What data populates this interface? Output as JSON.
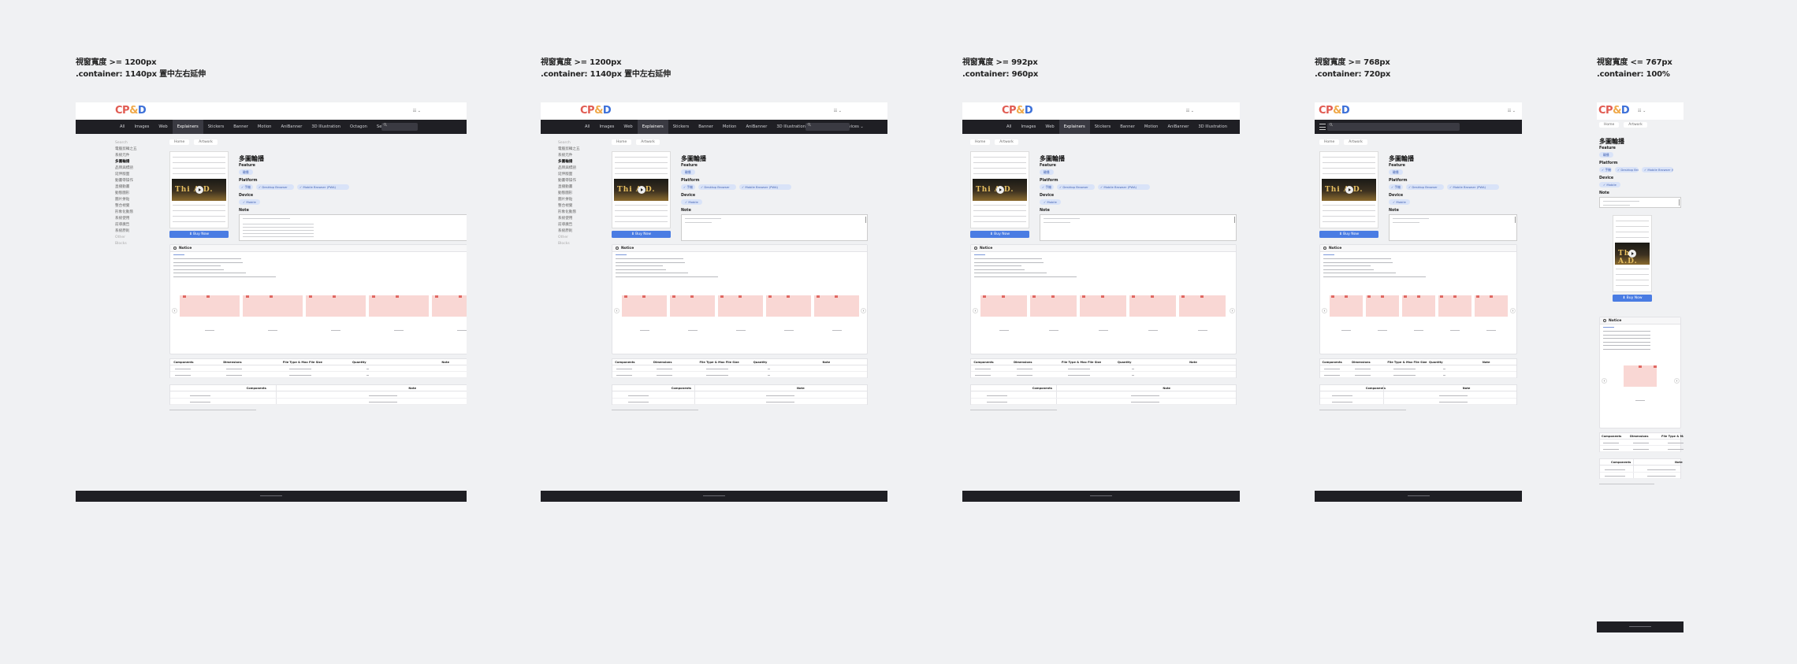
{
  "captions": [
    {
      "line1": "視窗寬度 >= 1200px",
      "line2": ".container: 1140px 置中左右延伸"
    },
    {
      "line1": "視窗寬度 >= 1200px",
      "line2": ".container: 1140px 置中左右延伸"
    },
    {
      "line1": "視窗寬度 >= 992px",
      "line2": ".container: 960px"
    },
    {
      "line1": "視窗寬度 >= 768px",
      "line2": ".container: 720px"
    },
    {
      "line1": "視窗寬度 <= 767px",
      "line2": ".container: 100%"
    }
  ],
  "logo": {
    "part1": "CP",
    "part2": "&",
    "part3": "D"
  },
  "nav": {
    "items": [
      "All",
      "Images",
      "Web",
      "Explainers",
      "Stickers",
      "Banner",
      "Motion",
      "AniBanner",
      "3D Illustration",
      "Octagon",
      "Services ⌄"
    ],
    "active_index": 3
  },
  "sidebar": {
    "items": [
      "Search",
      "電腦剪輯之五",
      "系統元件",
      "多圖輪播",
      "品牌與標語",
      "延伸版面",
      "動畫帶操作",
      "直播動畫",
      "動態圖形",
      "圖片拼貼",
      "整合視覺",
      "形象化動態",
      "系統使用",
      "前導廣告",
      "系統原則",
      "Other",
      "Blocks"
    ],
    "active_index": 3
  },
  "breadcrumbs": [
    "Home",
    "Artwork"
  ],
  "product": {
    "title": "多圖輪播",
    "feature_label": "Feature",
    "feature_chip": "輪播",
    "platform_label": "Platform",
    "platform_chips": [
      "✓ 手機",
      "✓ Desktop Browser",
      "✓ Mobile Browser (PWA)"
    ],
    "device_label": "Device",
    "device_chip": "✓ Mobile",
    "note_label": "Note",
    "download_label": "⬇ Buy Now",
    "thumb_text": "Thi  A.D."
  },
  "notice": {
    "title": "Notice"
  },
  "table1": {
    "headers": [
      "Components",
      "Dimensions",
      "File Type & Max File Size",
      "Quantity",
      "Note"
    ]
  },
  "table2": {
    "headers": [
      "Components",
      "Note"
    ]
  }
}
